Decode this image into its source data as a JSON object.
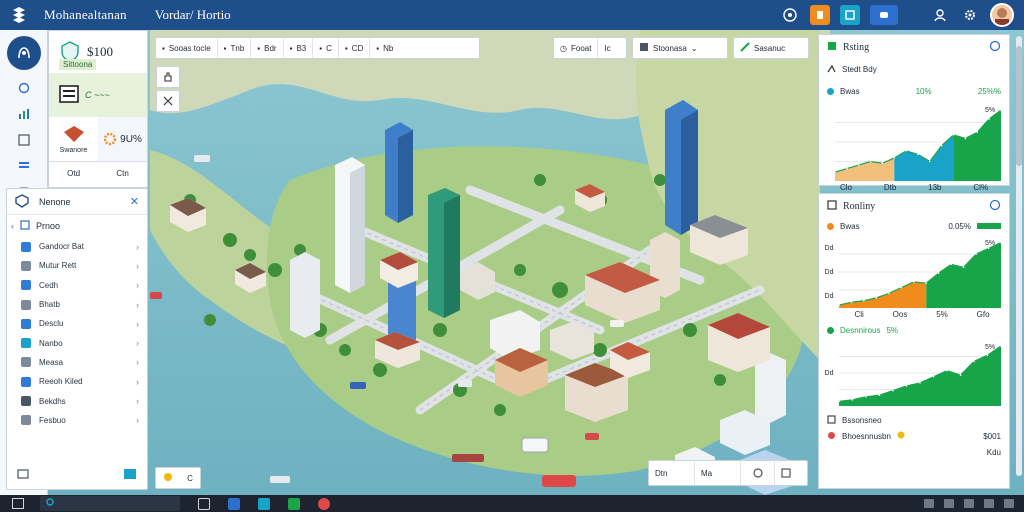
{
  "topbar": {
    "app_title": "Mohanealtanan",
    "sub_title": "Vordar/ Hortio",
    "icons": [
      "help-icon",
      "alert-icon",
      "map-icon",
      "chat-icon",
      "user-icon",
      "settings-icon",
      "avatar"
    ]
  },
  "status": {
    "money": "$100",
    "money_sub": "Sittoona",
    "trend_label": "C ~~~",
    "pct": "9U%",
    "res_label": "Swanore",
    "foot_a": "Otd",
    "foot_b": "Ctn"
  },
  "menu": {
    "title": "Nenone",
    "section": "Prnoo",
    "items": [
      {
        "label": "Gandocr Bat",
        "color": "#2f7bd8"
      },
      {
        "label": "Mutur Rett",
        "color": "#7c8a9c"
      },
      {
        "label": "Cedh",
        "color": "#2f7bd8"
      },
      {
        "label": "Bhatb",
        "color": "#7c8a9c"
      },
      {
        "label": "Desclu",
        "color": "#2f7bd8"
      },
      {
        "label": "Nanbo",
        "color": "#1aa3c9"
      },
      {
        "label": "Measa",
        "color": "#7c8a9c"
      },
      {
        "label": "Reeoh Kiled",
        "color": "#2f7bd8"
      },
      {
        "label": "Bekdhs",
        "color": "#4b5563"
      },
      {
        "label": "Fesbuo",
        "color": "#7c8a9c"
      }
    ]
  },
  "map_tools": {
    "strip1": [
      "Sooas tocle",
      "Tnb",
      "Bdr",
      "B3",
      "C",
      "CD",
      "Nb"
    ],
    "strip2": [
      "Fooat",
      "Ic"
    ],
    "strip3": "Stoonasa",
    "strip4": "Sasanuc",
    "bottom_left": "C",
    "bottom_center": [
      "Dtn",
      "Ma"
    ]
  },
  "panel1": {
    "title": "Rsting",
    "sub": "Stedt Bdy",
    "metric_label": "Bwas",
    "metric_a": "10%",
    "metric_b": "25%%",
    "peak_label": "5%",
    "x_ticks": [
      "Clo",
      "Dtb",
      "13b",
      "Cl%"
    ]
  },
  "panel2": {
    "title": "Ronliny",
    "metric_label": "Bwas",
    "metric_val": "0.05%",
    "peak_label": "5%",
    "y_ticks": [
      "Dd",
      "Dd",
      "Dd"
    ],
    "x_ticks": [
      "Cli",
      "Oos",
      "5%",
      "Gfo"
    ],
    "mid_label": "Desnnirous",
    "mid_val": "5%",
    "peak2": "5%",
    "footer_label": "Bssonsneo",
    "footer_row": "Bhoesnnusbn",
    "footer_val": "$001",
    "footer_last": "Kdu"
  },
  "chart_data": [
    {
      "type": "area",
      "title": "Rsting",
      "x": [
        0,
        1,
        2,
        3,
        4,
        5,
        6,
        7,
        8,
        9,
        10,
        11,
        12,
        13,
        14
      ],
      "series": [
        {
          "values": [
            10,
            14,
            18,
            22,
            20,
            26,
            34,
            30,
            22,
            40,
            52,
            48,
            55,
            70,
            80
          ]
        }
      ],
      "xticks": [
        "Clo",
        "Dtb",
        "13b",
        "Cl%"
      ],
      "colors": [
        "#f2c07a",
        "#1aa3c9",
        "#18a54a"
      ]
    },
    {
      "type": "area",
      "title": "Ronliny",
      "x": [
        0,
        1,
        2,
        3,
        4,
        5,
        6,
        7,
        8,
        9,
        10,
        11,
        12,
        13
      ],
      "series": [
        {
          "values": [
            4,
            8,
            10,
            14,
            20,
            28,
            36,
            34,
            48,
            60,
            56,
            74,
            82,
            90
          ]
        }
      ],
      "xticks": [
        "Cli",
        "Oos",
        "5%",
        "Gfo"
      ],
      "colors": [
        "#f08c1e",
        "#18a54a"
      ]
    },
    {
      "type": "area",
      "title": "Desnnirous",
      "x": [
        0,
        1,
        2,
        3,
        4,
        5,
        6,
        7,
        8,
        9,
        10,
        11,
        12
      ],
      "series": [
        {
          "values": [
            6,
            8,
            12,
            14,
            20,
            26,
            30,
            38,
            46,
            40,
            58,
            66,
            78
          ]
        }
      ],
      "colors": [
        "#18a54a"
      ]
    }
  ]
}
